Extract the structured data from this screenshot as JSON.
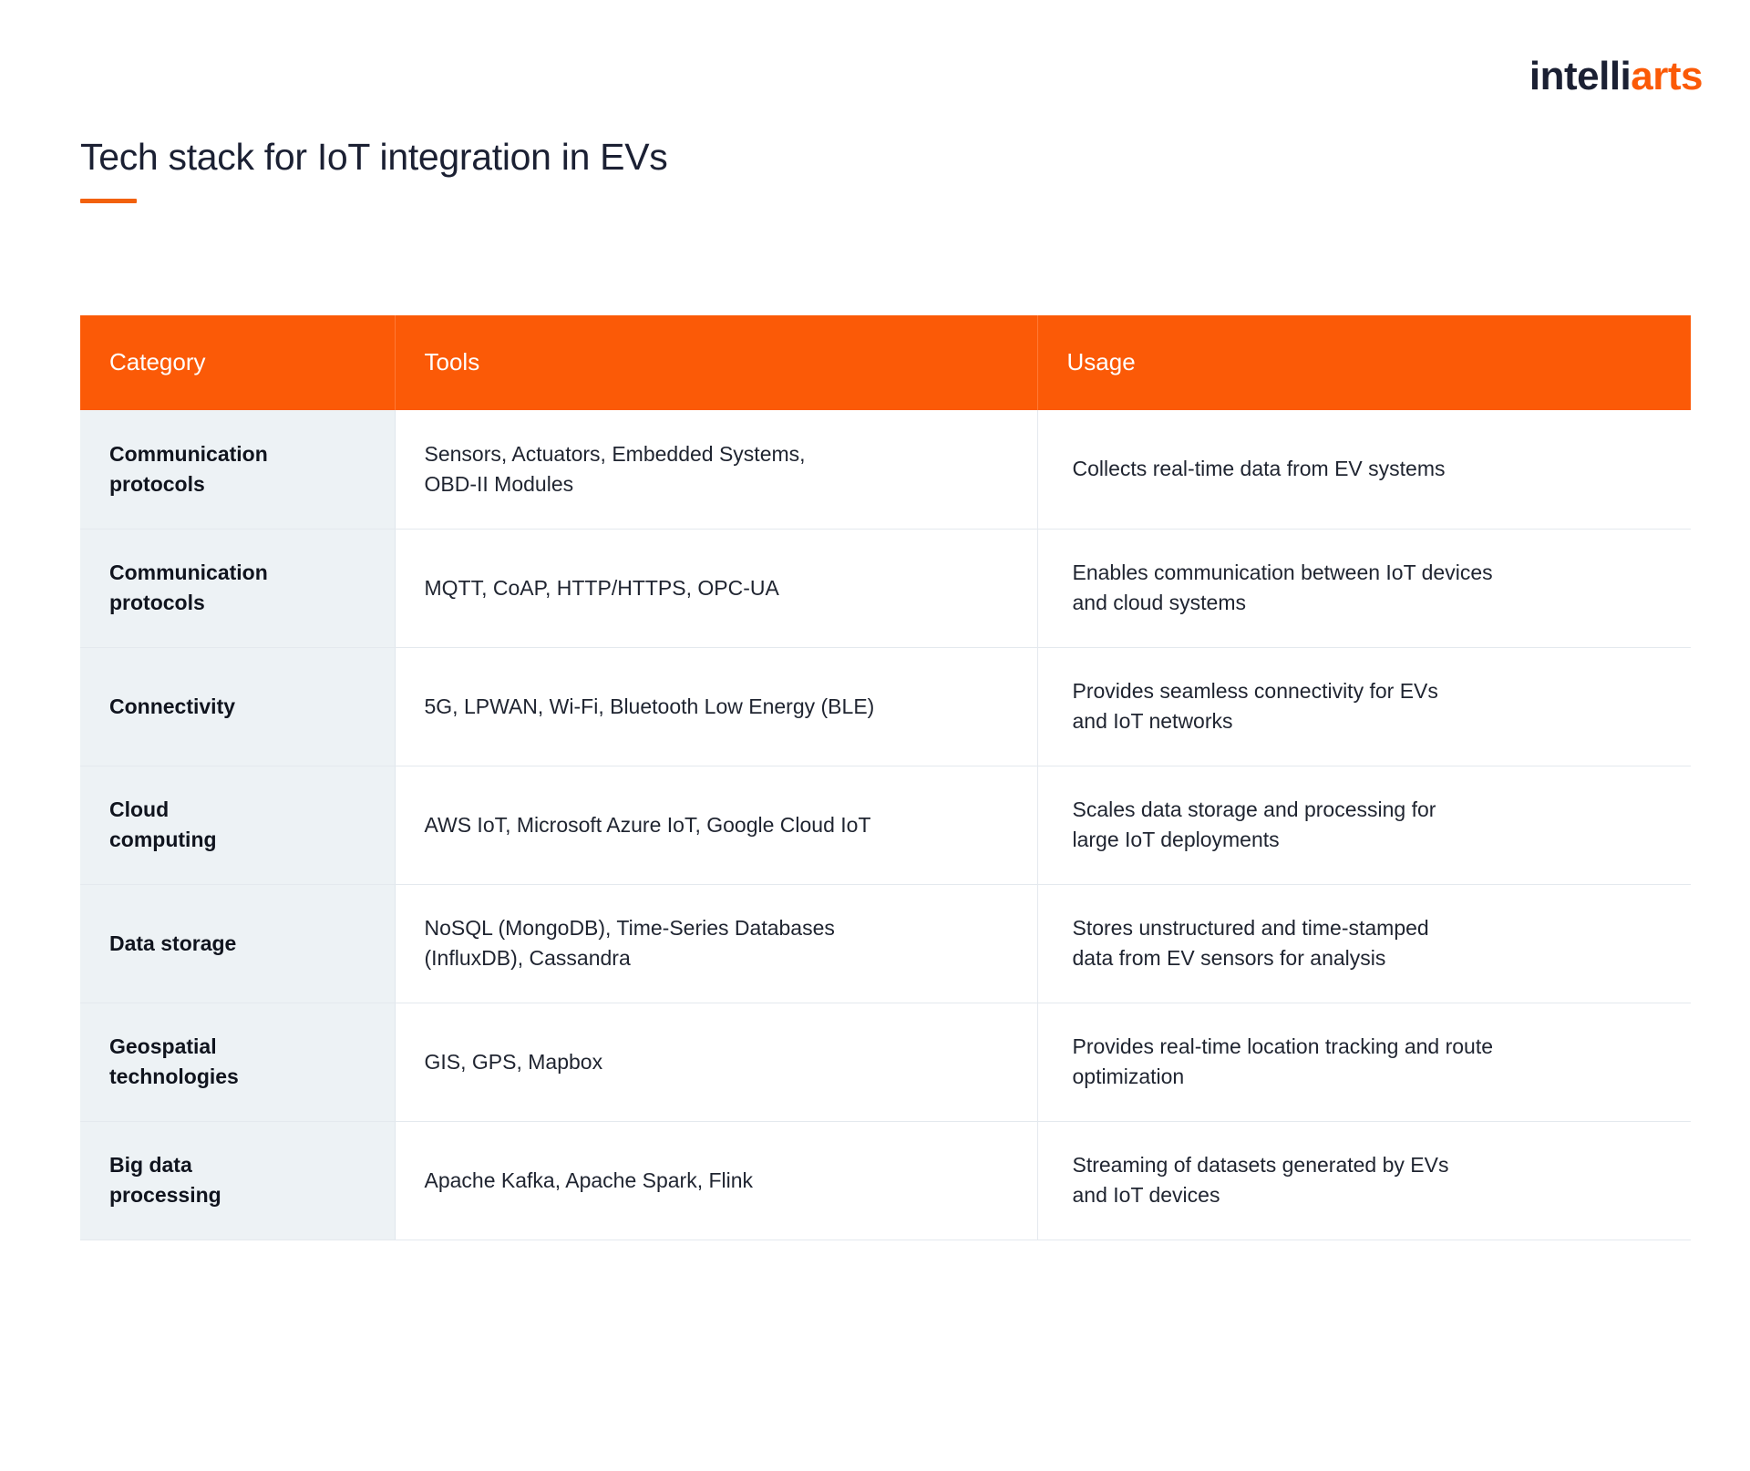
{
  "brand": {
    "logo_dark": "intelli",
    "logo_accent": "arts",
    "accent_color": "#fb5a07",
    "dark_color": "#1b2033"
  },
  "header": {
    "title": "Tech stack for IoT integration in EVs"
  },
  "table": {
    "columns": [
      "Category",
      "Tools",
      "Usage"
    ],
    "rows": [
      {
        "category": "Communication\nprotocols",
        "category_line1": "Communication",
        "category_line2": "protocols",
        "tools_line1": "Sensors, Actuators, Embedded Systems,",
        "tools_line2": "OBD-II Modules",
        "usage_line1": "Collects real-time data from EV systems",
        "usage_line2": ""
      },
      {
        "category": "Communication\nprotocols",
        "category_line1": "Communication",
        "category_line2": "protocols",
        "tools_line1": "MQTT, CoAP, HTTP/HTTPS, OPC-UA",
        "tools_line2": "",
        "usage_line1": "Enables communication between IoT devices",
        "usage_line2": "and cloud systems"
      },
      {
        "category": "Connectivity",
        "category_line1": "Connectivity",
        "category_line2": "",
        "tools_line1": "5G, LPWAN, Wi-Fi, Bluetooth Low Energy (BLE)",
        "tools_line2": "",
        "usage_line1": "Provides seamless connectivity for EVs",
        "usage_line2": "and IoT networks"
      },
      {
        "category": "Cloud\ncomputing",
        "category_line1": "Cloud",
        "category_line2": "computing",
        "tools_line1": "AWS IoT, Microsoft Azure IoT, Google Cloud IoT",
        "tools_line2": "",
        "usage_line1": "Scales data storage and processing for",
        "usage_line2": "large IoT deployments"
      },
      {
        "category": "Data storage",
        "category_line1": "Data storage",
        "category_line2": "",
        "tools_line1": "NoSQL (MongoDB), Time-Series Databases",
        "tools_line2": "(InfluxDB), Cassandra",
        "usage_line1": "Stores unstructured and time-stamped",
        "usage_line2": "data from EV sensors for analysis"
      },
      {
        "category": "Geospatial\ntechnologies",
        "category_line1": "Geospatial",
        "category_line2": "technologies",
        "tools_line1": "GIS, GPS, Mapbox",
        "tools_line2": "",
        "usage_line1": "Provides real-time location tracking and route",
        "usage_line2": "optimization"
      },
      {
        "category": "Big data\nprocessing",
        "category_line1": "Big data",
        "category_line2": "processing",
        "tools_line1": "Apache Kafka, Apache Spark, Flink",
        "tools_line2": "",
        "usage_line1": "Streaming of datasets generated by EVs",
        "usage_line2": "and IoT devices"
      }
    ]
  }
}
